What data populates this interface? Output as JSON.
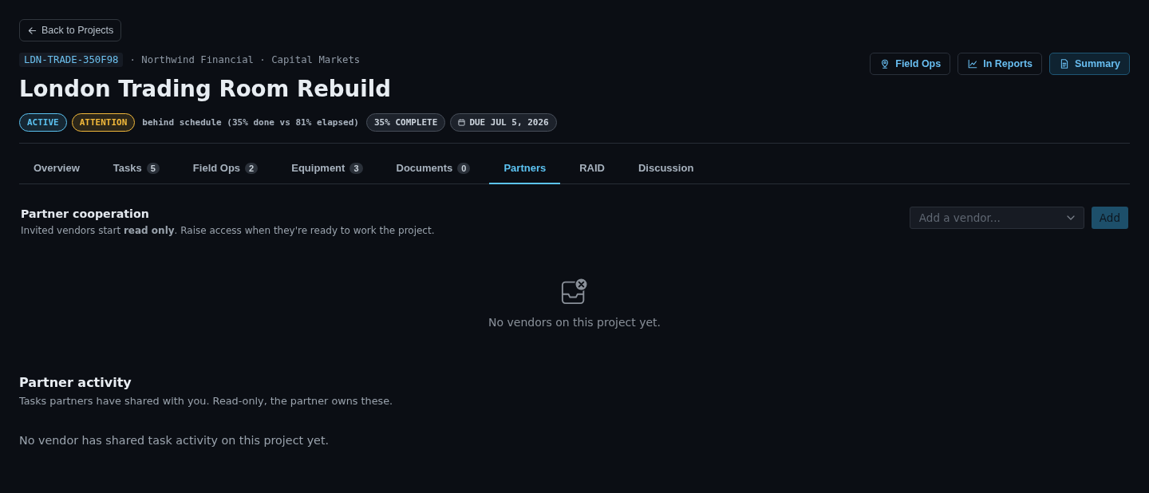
{
  "back_button": {
    "label": "Back to Projects"
  },
  "header": {
    "code": "LDN-TRADE-350F98",
    "meta": "· Northwind Financial · Capital Markets",
    "title": "London Trading Room Rebuild",
    "badges": [
      {
        "kind": "tag",
        "label": "ACTIVE",
        "color": "#5cc3f2"
      },
      {
        "kind": "tag",
        "label": "ATTENTION",
        "color": "#f2b93b"
      },
      {
        "kind": "note",
        "label": "behind schedule (35% done vs 81% elapsed)"
      },
      {
        "kind": "pill",
        "label": "35% COMPLETE"
      },
      {
        "kind": "date",
        "label": "DUE JUL 5, 2026"
      }
    ],
    "actions": [
      {
        "kind": "field",
        "label": "Field Ops",
        "primary": false
      },
      {
        "kind": "reports",
        "label": "In Reports",
        "primary": false
      },
      {
        "kind": "summary",
        "label": "Summary",
        "primary": true
      }
    ]
  },
  "tabs": [
    {
      "label": "Overview",
      "selected": false
    },
    {
      "label": "Tasks",
      "count": "5",
      "selected": false
    },
    {
      "label": "Field Ops",
      "count": "2",
      "selected": false
    },
    {
      "label": "Equipment",
      "count": "3",
      "selected": false
    },
    {
      "label": "Documents",
      "count": "0",
      "selected": false
    },
    {
      "label": "Partners",
      "selected": true
    },
    {
      "label": "RAID",
      "selected": false
    },
    {
      "label": "Discussion",
      "selected": false
    }
  ],
  "cooperation": {
    "title": "Partner cooperation",
    "description": "Invited vendors start **read only**. Raise access when they're ready to work the project.",
    "vendor_select": {
      "placeholder": "Add a vendor..."
    },
    "add_button": "Add",
    "empty_message": "No vendors on this project yet."
  },
  "activity": {
    "title": "Partner activity",
    "description": "Tasks partners have shared with you. Read-only, the partner owns these.",
    "empty_message": "No vendor has shared task activity on this project yet."
  }
}
